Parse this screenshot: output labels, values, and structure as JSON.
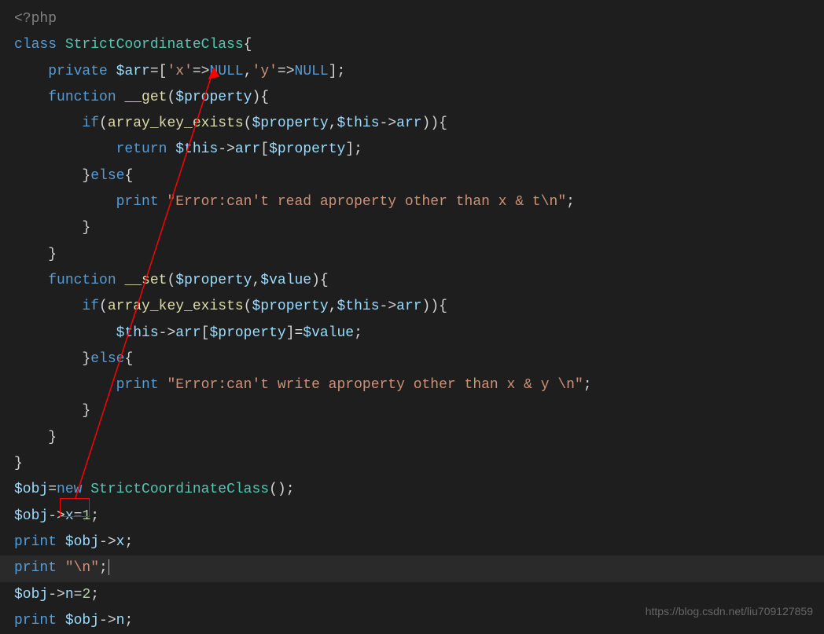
{
  "code": {
    "line1_open": "<?php",
    "line2_class": "class",
    "line2_name": " StrictCoordinateClass",
    "line2_brace": "{",
    "line3_indent": "    ",
    "line3_private": "private",
    "line3_var": " $arr",
    "line3_eq": "=[",
    "line3_sx": "'x'",
    "line3_arrow1": "=>",
    "line3_null1": "NULL",
    "line3_comma": ",",
    "line3_sy": "'y'",
    "line3_arrow2": "=>",
    "line3_null2": "NULL",
    "line3_close": "];",
    "line4_indent": "    ",
    "line4_function": "function",
    "line4_name": " __get",
    "line4_open": "(",
    "line4_param": "$property",
    "line4_close": "){",
    "line5_indent": "        ",
    "line5_if": "if",
    "line5_open": "(",
    "line5_fn": "array_key_exists",
    "line5_open2": "(",
    "line5_p1": "$property",
    "line5_comma": ",",
    "line5_this": "$this",
    "line5_arrow": "->",
    "line5_arr": "arr",
    "line5_close": ")){",
    "line6_indent": "            ",
    "line6_return": "return",
    "line6_sp": " ",
    "line6_this": "$this",
    "line6_arrow": "->",
    "line6_arr": "arr",
    "line6_open": "[",
    "line6_prop": "$property",
    "line6_close": "];",
    "line7_indent": "        }",
    "line7_else": "else",
    "line7_brace": "{",
    "line8_indent": "            ",
    "line8_print": "print",
    "line8_sp": " ",
    "line8_str": "\"Error:can't read aproperty other than x & t\\n\"",
    "line8_semi": ";",
    "line9_indent": "        }",
    "line10_indent": "    }",
    "line11_indent": "    ",
    "line11_function": "function",
    "line11_name": " __set",
    "line11_open": "(",
    "line11_p1": "$property",
    "line11_comma": ",",
    "line11_p2": "$value",
    "line11_close": "){",
    "line12_indent": "        ",
    "line12_if": "if",
    "line12_open": "(",
    "line12_fn": "array_key_exists",
    "line12_open2": "(",
    "line12_p1": "$property",
    "line12_comma": ",",
    "line12_this": "$this",
    "line12_arrow": "->",
    "line12_arr": "arr",
    "line12_close": ")){",
    "line13_indent": "            ",
    "line13_this": "$this",
    "line13_arrow": "->",
    "line13_arr": "arr",
    "line13_open": "[",
    "line13_prop": "$property",
    "line13_close": "]=",
    "line13_val": "$value",
    "line13_semi": ";",
    "line14_indent": "        }",
    "line14_else": "else",
    "line14_brace": "{",
    "line15_indent": "            ",
    "line15_print": "print",
    "line15_sp": " ",
    "line15_str": "\"Error:can't write aproperty other than x & y \\n\"",
    "line15_semi": ";",
    "line16_indent": "        }",
    "line17_indent": "    }",
    "line18_brace": "}",
    "line19_var": "$obj",
    "line19_eq": "=",
    "line19_new": "new",
    "line19_sp": " ",
    "line19_class": "StrictCoordinateClass",
    "line19_call": "();",
    "line20_var": "$obj",
    "line20_arrow": "->",
    "line20_prop": "x",
    "line20_eq": "=",
    "line20_num": "1",
    "line20_semi": ";",
    "line21_print": "print",
    "line21_sp": " ",
    "line21_var": "$obj",
    "line21_arrow": "->",
    "line21_prop": "x",
    "line21_semi": ";",
    "line22_print": "print",
    "line22_sp": " ",
    "line22_str": "\"\\n\"",
    "line22_semi": ";",
    "line23_var": "$obj",
    "line23_arrow": "->",
    "line23_prop": "n",
    "line23_eq": "=",
    "line23_num": "2",
    "line23_semi": ";",
    "line24_print": "print",
    "line24_sp": " ",
    "line24_var": "$obj",
    "line24_arrow": "->",
    "line24_prop": "n",
    "line24_semi": ";"
  },
  "watermark": "https://blog.csdn.net/liu709127859"
}
